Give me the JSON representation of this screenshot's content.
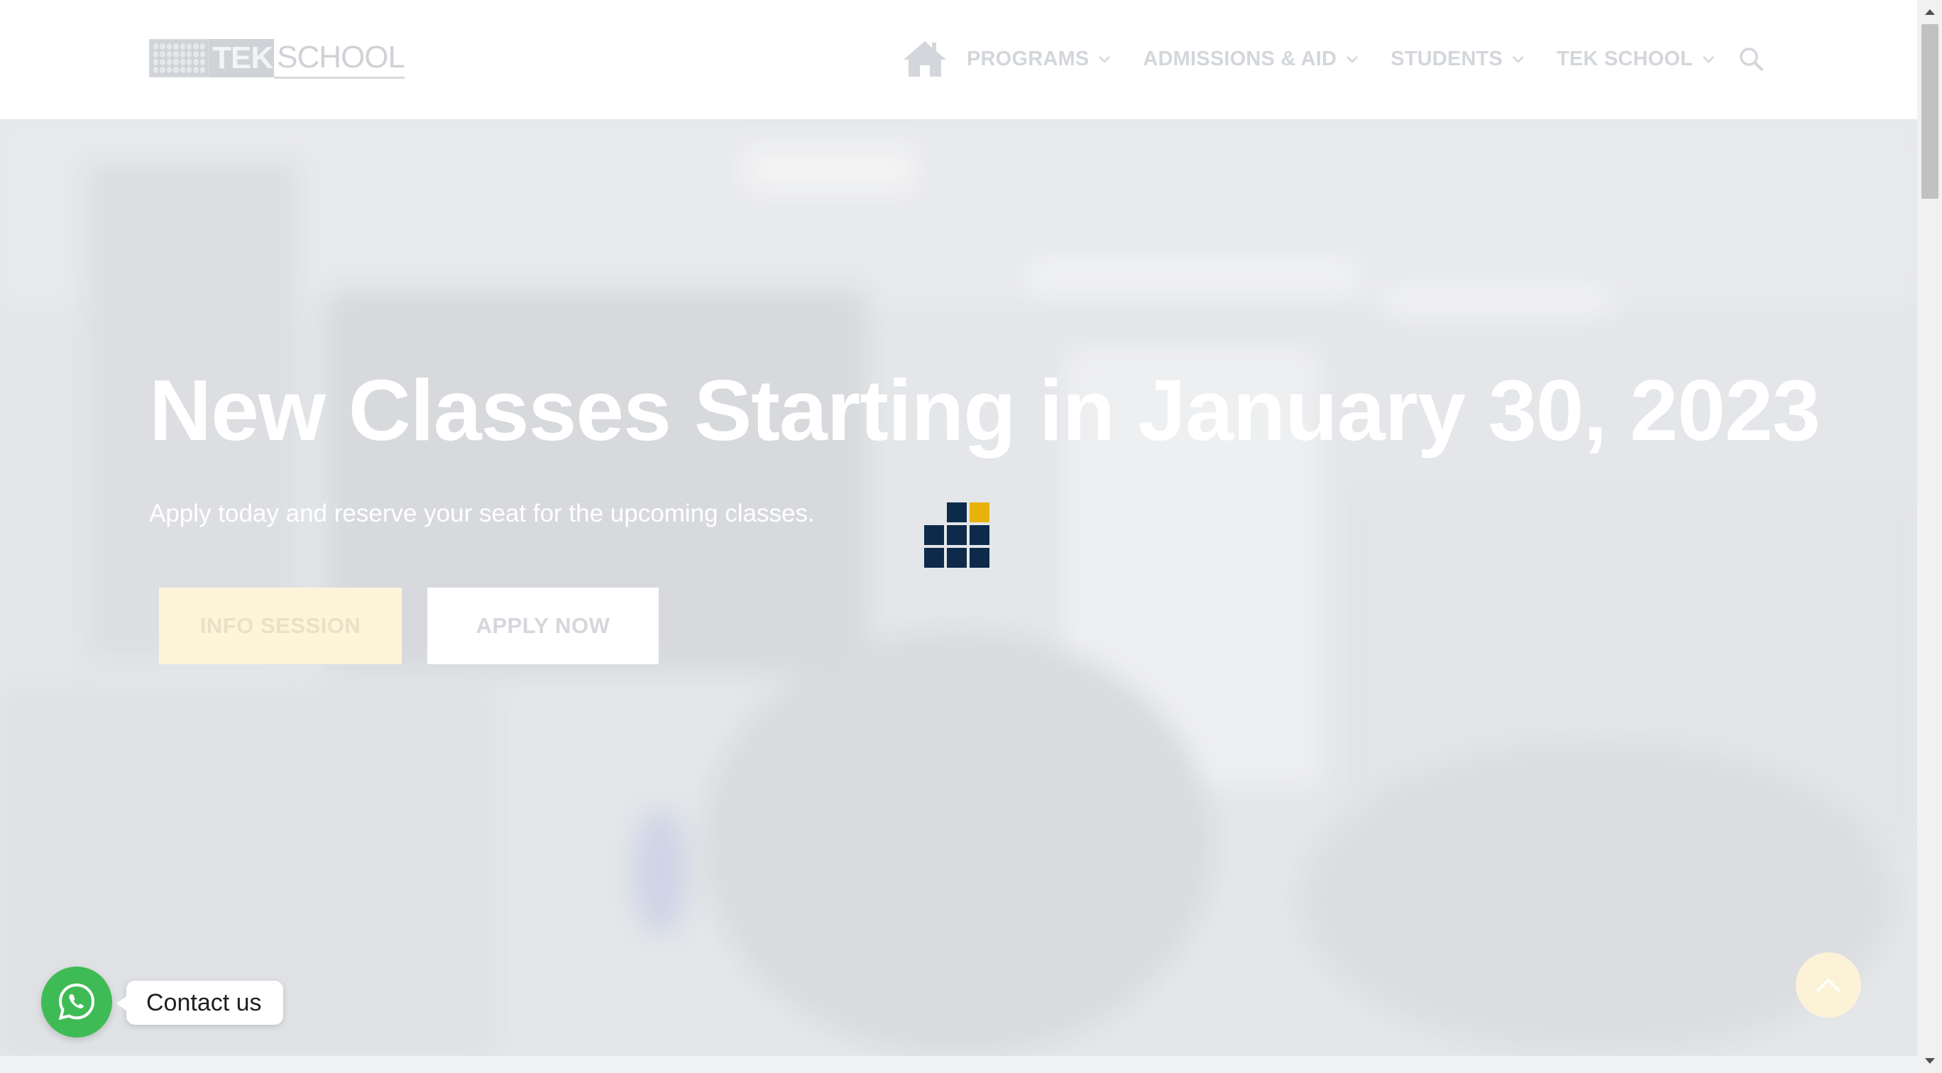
{
  "header": {
    "logo": {
      "text_tek": "TEK",
      "text_school": "SCHOOL"
    },
    "nav": [
      {
        "label": "PROGRAMS",
        "icon": "chevron-down-icon"
      },
      {
        "label": "ADMISSIONS & AID",
        "icon": "chevron-down-icon"
      },
      {
        "label": "STUDENTS",
        "icon": "chevron-down-icon"
      },
      {
        "label": "TEK SCHOOL",
        "icon": "chevron-down-icon"
      }
    ],
    "icons": {
      "home": "home-icon",
      "search": "search-icon"
    }
  },
  "hero": {
    "title": "New Classes Starting in January 30, 2023",
    "subtitle": "Apply today and reserve your seat for the upcoming classes.",
    "buttons": {
      "info_session": "INFO SESSION",
      "apply_now": "APPLY NOW"
    }
  },
  "widgets": {
    "contact_label": "Contact us",
    "contact_icon": "whatsapp-icon",
    "back_to_top_icon": "chevron-up-icon"
  },
  "colors": {
    "loader_navy": "#0e2a4a",
    "loader_gold": "#e8b20d",
    "whatsapp_green": "#3fbb56",
    "info_button_bg": "#fdf4da"
  }
}
